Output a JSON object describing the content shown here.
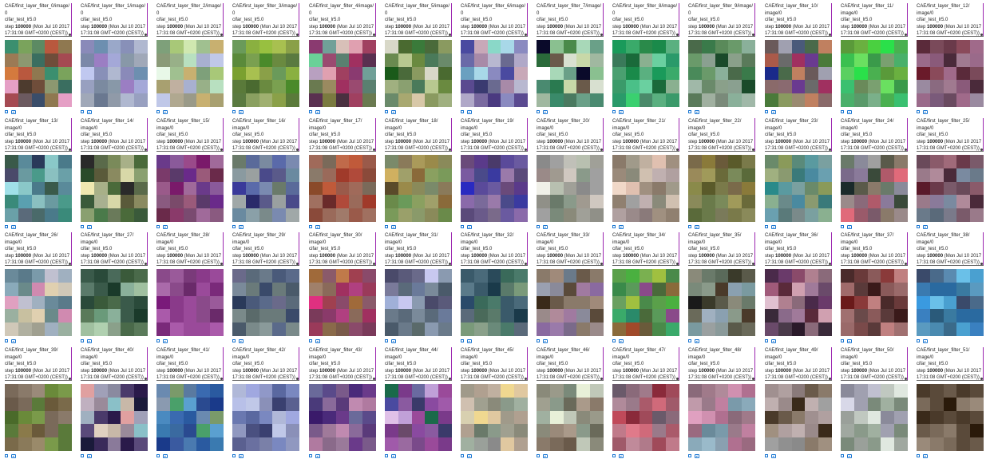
{
  "common": {
    "image_label": "image/0",
    "run": "cifar_test_lr5.0",
    "step_label": "step",
    "step_value": "100000",
    "date_line1": "(Mon Jul 10 2017",
    "date_line2": "17:31:08 GMT+0200 (CEST))"
  },
  "cards": [
    {
      "tag": "CAE/first_layer_filter_0/image/",
      "sub": "0"
    },
    {
      "tag": "CAE/first_layer_filter_1/image/",
      "sub": "0"
    },
    {
      "tag": "CAE/first_layer_filter_2/image/",
      "sub": "0"
    },
    {
      "tag": "CAE/first_layer_filter_3/image/",
      "sub": "0"
    },
    {
      "tag": "CAE/first_layer_filter_4/image/",
      "sub": "0"
    },
    {
      "tag": "CAE/first_layer_filter_5/image/",
      "sub": "0"
    },
    {
      "tag": "CAE/first_layer_filter_6/image/",
      "sub": "0"
    },
    {
      "tag": "CAE/first_layer_filter_7/image/",
      "sub": "0"
    },
    {
      "tag": "CAE/first_layer_filter_8/image/",
      "sub": "0"
    },
    {
      "tag": "CAE/first_layer_filter_9/image/",
      "sub": "0"
    },
    {
      "tag": "CAE/first_layer_filter_10/",
      "sub": "image/0"
    },
    {
      "tag": "CAE/first_layer_filter_11/",
      "sub": "image/0"
    },
    {
      "tag": "CAE/first_layer_filter_12/",
      "sub": "image/0"
    },
    {
      "tag": "CAE/first_layer_filter_13/",
      "sub": "image/0"
    },
    {
      "tag": "CAE/first_layer_filter_14/",
      "sub": "image/0"
    },
    {
      "tag": "CAE/first_layer_filter_15/",
      "sub": "image/0"
    },
    {
      "tag": "CAE/first_layer_filter_16/",
      "sub": "image/0"
    },
    {
      "tag": "CAE/first_layer_filter_17/",
      "sub": "image/0"
    },
    {
      "tag": "CAE/first_layer_filter_18/",
      "sub": "image/0"
    },
    {
      "tag": "CAE/first_layer_filter_19/",
      "sub": "image/0"
    },
    {
      "tag": "CAE/first_layer_filter_20/",
      "sub": "image/0"
    },
    {
      "tag": "CAE/first_layer_filter_21/",
      "sub": "image/0"
    },
    {
      "tag": "CAE/first_layer_filter_22/",
      "sub": "image/0"
    },
    {
      "tag": "CAE/first_layer_filter_23/",
      "sub": "image/0"
    },
    {
      "tag": "CAE/first_layer_filter_24/",
      "sub": "image/0"
    },
    {
      "tag": "CAE/first_layer_filter_25/",
      "sub": "image/0"
    },
    {
      "tag": "CAE/first_layer_filter_26/",
      "sub": "image/0"
    },
    {
      "tag": "CAE/first_layer_filter_27/",
      "sub": "image/0"
    },
    {
      "tag": "CAE/first_layer_filter_28/",
      "sub": "image/0"
    },
    {
      "tag": "CAE/first_layer_filter_29/",
      "sub": "image/0"
    },
    {
      "tag": "CAE/first_layer_filter_30/",
      "sub": "image/0"
    },
    {
      "tag": "CAE/first_layer_filter_31/",
      "sub": "image/0"
    },
    {
      "tag": "CAE/first_layer_filter_32/",
      "sub": "image/0"
    },
    {
      "tag": "CAE/first_layer_filter_33/",
      "sub": "image/0"
    },
    {
      "tag": "CAE/first_layer_filter_34/",
      "sub": "image/0"
    },
    {
      "tag": "CAE/first_layer_filter_35/",
      "sub": "image/0"
    },
    {
      "tag": "CAE/first_layer_filter_36/",
      "sub": "image/0"
    },
    {
      "tag": "CAE/first_layer_filter_37/",
      "sub": "image/0"
    },
    {
      "tag": "CAE/first_layer_filter_38/",
      "sub": "image/0"
    },
    {
      "tag": "CAE/first_layer_filter_39/",
      "sub": "image/0"
    },
    {
      "tag": "CAE/first_layer_filter_40/",
      "sub": "image/0"
    },
    {
      "tag": "CAE/first_layer_filter_41/",
      "sub": "image/0"
    },
    {
      "tag": "CAE/first_layer_filter_42/",
      "sub": "image/0"
    },
    {
      "tag": "CAE/first_layer_filter_43/",
      "sub": "image/0"
    },
    {
      "tag": "CAE/first_layer_filter_44/",
      "sub": "image/0"
    },
    {
      "tag": "CAE/first_layer_filter_45/",
      "sub": "image/0"
    },
    {
      "tag": "CAE/first_layer_filter_46/",
      "sub": "image/0"
    },
    {
      "tag": "CAE/first_layer_filter_47/",
      "sub": "image/0"
    },
    {
      "tag": "CAE/first_layer_filter_48/",
      "sub": "image/0"
    },
    {
      "tag": "CAE/first_layer_filter_49/",
      "sub": "image/0"
    },
    {
      "tag": "CAE/first_layer_filter_50/",
      "sub": "image/0"
    },
    {
      "tag": "CAE/first_layer_filter_51/",
      "sub": "image/0"
    }
  ],
  "palettes": [
    [
      "#3b8f6f",
      "#7aa35c",
      "#5c8a63",
      "#9b7a55",
      "#8c9870",
      "#3a6e60",
      "#d47a3e",
      "#b9583e",
      "#8f7850",
      "#e59fc5",
      "#4d3b2e",
      "#6f4d3a",
      "#a54a52",
      "#6c5a60",
      "#3a4d6a"
    ],
    [
      "#8a8ab9",
      "#6d8fb0",
      "#9aa8c9",
      "#7b88a8",
      "#9b7ec3",
      "#a4a8d8",
      "#c0c8f0",
      "#8890b8",
      "#b0b8d0",
      "#98a0c0",
      "#7b8aa0",
      "#8898a8",
      "#a0a8b8",
      "#6a7890",
      "#909aa8"
    ],
    [
      "#7ea07a",
      "#a8c878",
      "#d0e8b0",
      "#8a9a78",
      "#98b088",
      "#b8e0c0",
      "#e8f8e8",
      "#a0c090",
      "#c8b070",
      "#a8a070",
      "#c0b0a0",
      "#a8b0d0",
      "#c0c8e8",
      "#b0a890",
      "#9a9a88"
    ],
    [
      "#6a9a5a",
      "#8ab040",
      "#98c040",
      "#5a8a3a",
      "#7aa050",
      "#4a8a2a",
      "#7aa030",
      "#a8c050",
      "#8aa048",
      "#5a7a3a",
      "#4a6a30",
      "#6a8a40",
      "#5a7a40",
      "#8aa060",
      "#a0b070"
    ],
    [
      "#8a3a70",
      "#70a098",
      "#d8c0b8",
      "#6ad098",
      "#9a4a70",
      "#5a8070",
      "#b8a0c0",
      "#e0a0b0",
      "#a04060",
      "#6a7a50",
      "#9a8a60",
      "#a03060",
      "#5a3050",
      "#7a7a40",
      "#4a3040"
    ],
    [
      "#d8d8c8",
      "#4a6a30",
      "#3a7a3a",
      "#6a8a50",
      "#b8c890",
      "#6a8a40",
      "#1a5a1a",
      "#4a6a3a",
      "#8a9a60",
      "#a0b080",
      "#8aa070",
      "#4a7a5a",
      "#6a8a6a",
      "#a8a870",
      "#d8c8a8"
    ],
    [
      "#4a4aa0",
      "#c8a8b8",
      "#8ad8c8",
      "#6a6aa8",
      "#a88aa8",
      "#b8b8d0",
      "#6aa0c0",
      "#a8d8e8",
      "#8a8ac0",
      "#5a4a90",
      "#3a3a70",
      "#6a6a90",
      "#b0a8c8",
      "#7a6aa0",
      "#4a3a80"
    ],
    [
      "#0a0a2a",
      "#8ac090",
      "#4a8a4a",
      "#2a6a3a",
      "#6a5a4a",
      "#d8e0d0",
      "#ffffff",
      "#a8d8b8",
      "#6aa088",
      "#4a8a70",
      "#2a7a50",
      "#c8d8a8",
      "#a0b8a0",
      "#3a8a6a",
      "#4a7a60"
    ],
    [
      "#1a9a5a",
      "#3aaa6a",
      "#2a8a4a",
      "#3a7a5a",
      "#1a6a3a",
      "#8ab090",
      "#4aa070",
      "#1a8a4a",
      "#5ab080",
      "#3a9a6a",
      "#4ac088",
      "#6ad0a0",
      "#2a9a6a",
      "#3ad070",
      "#4a8a6a"
    ],
    [
      "#4a6a4a",
      "#3a7a4a",
      "#5a8a5a",
      "#6a9a6a",
      "#8aa090",
      "#1a4a2a",
      "#4a8a5a",
      "#6a9a6a",
      "#8ab09a",
      "#a0b8a8",
      "#6a8a6a",
      "#8aa08a",
      "#5a7a5a",
      "#a0b0a0",
      "#7a8a7a"
    ],
    [
      "#6a5a5a",
      "#a0a0b0",
      "#4a5a7a",
      "#aa5a4a",
      "#6a6a6a",
      "#a03060",
      "#1a2a8a",
      "#4a6a4a",
      "#c08060",
      "#8a6a6a",
      "#8a6a70",
      "#6a3a90",
      "#4a7a3a",
      "#8a9a60",
      "#9a8a70"
    ],
    [
      "#5a9a3a",
      "#6ab040",
      "#4ad040",
      "#3ac050",
      "#6ae060",
      "#3a9a4a",
      "#5ad060",
      "#2ae04a",
      "#4ab050",
      "#3ac070",
      "#6a8a5a",
      "#7aa070",
      "#4ab06a",
      "#5a9a6a",
      "#7ab08a"
    ],
    [
      "#5a2a3a",
      "#7a4a5a",
      "#6a3a4a",
      "#9a6a8a",
      "#8a5a7a",
      "#4a2a3a",
      "#6a1a2a",
      "#8a4a5a",
      "#a06a8a",
      "#9a8aa0",
      "#8a6a80",
      "#a07a90",
      "#9a6a8a",
      "#7a5a7a",
      "#6a4a60"
    ],
    [
      "#3a5a4a",
      "#5a8a9a",
      "#2a3a5a",
      "#4a4a6a",
      "#6a9aa0",
      "#4a9a8a",
      "#a0e0e8",
      "#8ac8c8",
      "#4a7a8a",
      "#3a8a7a",
      "#5aa0b0",
      "#8ac0c0",
      "#6aa0a8",
      "#5a6a7a",
      "#4a6a6a"
    ],
    [
      "#2a2a2a",
      "#5a6a4a",
      "#7a8a5a",
      "#2a4a2a",
      "#5a5a3a",
      "#8a8a60",
      "#f0e8b0",
      "#a8b088",
      "#4a6a3a",
      "#3a5a3a",
      "#a8b090",
      "#d8d8a8",
      "#8aa070",
      "#4a7a4a",
      "#6a7a5a"
    ],
    [
      "#6a3a8a",
      "#8a5a9a",
      "#9a4a8a",
      "#7a3a6a",
      "#5a3a6a",
      "#6a2a8a",
      "#9a5a8a",
      "#7a1a6a",
      "#a06a9a",
      "#8a5a80",
      "#7a4a6a",
      "#9a5a7a",
      "#6a2a4a",
      "#8a3a6a",
      "#7a4a70"
    ],
    [
      "#6a7a6a",
      "#5a6a9a",
      "#7a8aa0",
      "#8a9aa0",
      "#9aa0a0",
      "#4a4a8a",
      "#3a3a9a",
      "#5a6aaa",
      "#7a8ab0",
      "#a0a8a8",
      "#2a2a6a",
      "#5a5a8a",
      "#6a8aa0",
      "#8aa0a8",
      "#7a8a8a"
    ],
    [
      "#a06a5a",
      "#7a6a5a",
      "#c06a4a",
      "#8a7a6a",
      "#9a6a5a",
      "#a03a2a",
      "#8a4a2a",
      "#c05a3a",
      "#9a5a4a",
      "#a07060",
      "#6a2a2a",
      "#b04a3a",
      "#8a4a3a",
      "#9a6a5a",
      "#a07a6a"
    ],
    [
      "#7a8a6a",
      "#8a7a5a",
      "#aa9a5a",
      "#d0b060",
      "#a0a06a",
      "#8a6a3a",
      "#5a4a2a",
      "#9a8a4a",
      "#8a8a5a",
      "#6a8a4a",
      "#6a9a5a",
      "#8aa060",
      "#7a9a5a",
      "#9aa06a",
      "#8a9a6a"
    ],
    [
      "#6a4a7a",
      "#5a3a8a",
      "#4a3a6a",
      "#7a5aa0",
      "#4a4a8a",
      "#3a3aa0",
      "#2a2ac0",
      "#5a4a9a",
      "#6a5aa0",
      "#8a6aaa",
      "#7a6a9a",
      "#9a7aaa",
      "#5a4a7a",
      "#6a5a8a",
      "#7a6a8a"
    ],
    [
      "#8a8a8a",
      "#a0a0a0",
      "#c0c0b8",
      "#9a8a88",
      "#a09a90",
      "#d0c8c0",
      "#f0f0e8",
      "#b8c0b0",
      "#a0a098",
      "#909088",
      "#6a7a6a",
      "#8a9a8a",
      "#a0a0a0",
      "#7a8a7a",
      "#8a8a7a"
    ],
    [
      "#8a7a6a",
      "#a09a8a",
      "#c0b0a0",
      "#9a8a7a",
      "#8a8a7a",
      "#d0c0b0",
      "#f0d8c8",
      "#e0c0b0",
      "#a09080",
      "#908070",
      "#a0a0a0",
      "#c0b0b0",
      "#b0a0a0",
      "#9a8a8a",
      "#8a7a7a"
    ],
    [
      "#7a6a4a",
      "#8a7a3a",
      "#6a5a3a",
      "#9a8a5a",
      "#a09a5a",
      "#6a6a3a",
      "#8a8a4a",
      "#5a5a2a",
      "#7a7a4a",
      "#8a8a5a",
      "#6a7a4a",
      "#7a8a5a",
      "#5a6a3a",
      "#6a7a4a",
      "#7a7a5a"
    ],
    [
      "#6a8a6a",
      "#8a9a5a",
      "#5a8a7a",
      "#a0b080",
      "#8a9a70",
      "#3a7a7a",
      "#2a8a8a",
      "#5a9aa0",
      "#7aa0a0",
      "#8ab090",
      "#6a8a8a",
      "#4a8aa0",
      "#6aa0b0",
      "#5a7a7a",
      "#7a8a8a"
    ],
    [
      "#6a7a6a",
      "#8a8a9a",
      "#a0a0a0",
      "#7a6a8a",
      "#8a7a9a",
      "#3a4a3a",
      "#1a2a2a",
      "#5a5a4a",
      "#8a7a6a",
      "#9a8a8a",
      "#8a6a7a",
      "#b05a6a",
      "#e06a7a",
      "#9a5a6a",
      "#7a5a6a"
    ],
    [
      "#6a4a5a",
      "#8a5a6a",
      "#a06a7a",
      "#9a7a8a",
      "#b08a9a",
      "#4a2a3a",
      "#5a1a2a",
      "#6a3a4a",
      "#7a5a6a",
      "#9a7a8a",
      "#8a7a9a",
      "#7a8aa0",
      "#6a7a8a",
      "#5a6a7a",
      "#7a7a8a"
    ],
    [
      "#6a8a9a",
      "#5a7a8a",
      "#7a9aaa",
      "#8aaaba",
      "#6a8a8a",
      "#d08ab0",
      "#e0a0c0",
      "#c0c0d0",
      "#a0b0c0",
      "#9ab0a0",
      "#c8c0a0",
      "#e0d0b0",
      "#d0c8b8",
      "#b0b0a0",
      "#a0a090"
    ],
    [
      "#3a5a4a",
      "#2a4a3a",
      "#4a6a5a",
      "#5a7a6a",
      "#3a5a4a",
      "#1a3a2a",
      "#2a4a3a",
      "#3a5a3a",
      "#4a6a4a",
      "#5a7a5a",
      "#6a9a7a",
      "#8ab09a",
      "#a0c0a0",
      "#b0d0b0",
      "#8aa08a"
    ],
    [
      "#8a4a8a",
      "#9a5a9a",
      "#7a3a7a",
      "#aa6aaa",
      "#8a4a8a",
      "#6a2a6a",
      "#7a1a7a",
      "#8a3a8a",
      "#9a4a9a",
      "#aa5aaa",
      "#8a3a8a",
      "#9a4a9a",
      "#7a2a7a",
      "#aa5aaa",
      "#9a4a9a"
    ],
    [
      "#6a6a8a",
      "#5a6a7a",
      "#6a7a8a",
      "#7a8a9a",
      "#6a7a7a",
      "#3a4a6a",
      "#2a3a5a",
      "#4a5a7a",
      "#5a6a8a",
      "#7a8a8a",
      "#5a6a6a",
      "#6a7a7a",
      "#4a5a6a",
      "#7a8a8a",
      "#8a9a9a"
    ],
    [
      "#a06a3a",
      "#8a5a6a",
      "#c07a4a",
      "#a0806a",
      "#8a6a5a",
      "#a03060",
      "#e03080",
      "#a04050",
      "#8a4a6a",
      "#7a3a5a",
      "#8a3a6a",
      "#b04080",
      "#9a3a5a",
      "#8a6a4a",
      "#7a5a4a"
    ],
    [
      "#4a4a6a",
      "#5a5a7a",
      "#6a6a8a",
      "#7a7a9a",
      "#5a6a7a",
      "#6a7a9a",
      "#a0b0d8",
      "#c8c8f0",
      "#8a9ab0",
      "#6a7a8a",
      "#5a6a7a",
      "#7a8a9a",
      "#4a5a6a",
      "#6a7a8a",
      "#5a6a6a"
    ],
    [
      "#3a5a6a",
      "#4a6a7a",
      "#2a4a5a",
      "#5a7a8a",
      "#3a5a6a",
      "#1a3a4a",
      "#2a4a6a",
      "#3a6a5a",
      "#4a7a6a",
      "#5a6a7a",
      "#4a6a5a",
      "#5a7a6a",
      "#7a9a7a",
      "#8aa08a",
      "#6a8a7a"
    ],
    [
      "#8a7a6a",
      "#a08a7a",
      "#6a7a8a",
      "#9aa0b0",
      "#8a8a9a",
      "#5a4a3a",
      "#3a2a1a",
      "#6a5a4a",
      "#8a7a6a",
      "#9a8a8a",
      "#b08a9a",
      "#a07aa0",
      "#8a6aa0",
      "#9a7aaa",
      "#7a6a8a"
    ],
    [
      "#5aa04a",
      "#4ab040",
      "#7ab050",
      "#3a8a4a",
      "#5a9a5a",
      "#8a4a8a",
      "#6aa060",
      "#a0c040",
      "#4a8a4a",
      "#3aaa6a",
      "#2a8a6a",
      "#4a6a3a",
      "#8a6a3a",
      "#a04a2a",
      "#6a5a3a"
    ],
    [
      "#8a8a7a",
      "#6a7a6a",
      "#5a6a5a",
      "#7a8a7a",
      "#8a9a8a",
      "#4a3a2a",
      "#1a1a1a",
      "#3a3a2a",
      "#5a5a4a",
      "#6a6a5a",
      "#a0b0c0",
      "#8aa0b0",
      "#7a9aa0",
      "#9aa0a0",
      "#8a9a9a"
    ],
    [
      "#4a2a4a",
      "#6a3a6a",
      "#8a4a6a",
      "#a05a7a",
      "#5a2a3a",
      "#d0a0b0",
      "#e0c0d0",
      "#b08090",
      "#8a6a7a",
      "#3a2a3a",
      "#8a6a8a",
      "#a07a9a",
      "#6a4a6a",
      "#4a3a4a",
      "#2a1a2a"
    ],
    [
      "#4a2a2a",
      "#6a3a3a",
      "#8a5a5a",
      "#a06a6a",
      "#5a3a3a",
      "#3a1a1a",
      "#6a1a1a",
      "#8a3a3a",
      "#c08080",
      "#a07070",
      "#6a4a4a",
      "#8a5a5a",
      "#9a6a6a",
      "#7a4a4a",
      "#5a3a3a"
    ],
    [
      "#3a4a6a",
      "#4a6a8a",
      "#5a8ab0",
      "#3a7ab0",
      "#2a6aa0",
      "#2a6aa0",
      "#3a9ae0",
      "#6ac0e8",
      "#4aa0d0",
      "#3a80c0",
      "#2a5a7a",
      "#3a7aa0",
      "#5a9ac0",
      "#4a8ab0",
      "#3a6a8a"
    ],
    [
      "#7a6a5a",
      "#8a7a6a",
      "#9a8a7a",
      "#6a5a4a",
      "#7a6a5a",
      "#5a7a3a",
      "#4a6a2a",
      "#6a8a3a",
      "#7a9a4a",
      "#5a7a3a",
      "#8a7a4a",
      "#6a5a3a",
      "#7a6a4a",
      "#8a7a5a",
      "#9a8a6a"
    ],
    [
      "#e0a0a0",
      "#a0a0b8",
      "#8a8aa0",
      "#c0b0c0",
      "#9a8a9a",
      "#8ac0c8",
      "#a0b0c0",
      "#4a3a6a",
      "#2a1a4a",
      "#5a4a7a",
      "#e0d0c0",
      "#c8b8a8",
      "#1a1a3a",
      "#3a2a5a",
      "#8a7a9a"
    ],
    [
      "#6a8ab0",
      "#7a9a6a",
      "#5a7aa0",
      "#8a9ab0",
      "#4aa06a",
      "#5aa0d0",
      "#4a8ac0",
      "#3a6ab0",
      "#2a5aa0",
      "#3a7ab0",
      "#3a6aa0",
      "#2a4a90",
      "#1a3a8a",
      "#3a5aa0",
      "#4a7ab0"
    ],
    [
      "#b0b8d8",
      "#a0a8e0",
      "#9098c8",
      "#b8c0e8",
      "#c0c8e8",
      "#8a90b8",
      "#6a78b0",
      "#5a68a0",
      "#7a88c0",
      "#9098c0",
      "#4a5080",
      "#3a4070",
      "#5a6090",
      "#6a70a0",
      "#7a80a8"
    ],
    [
      "#6a6a9a",
      "#5a4a8a",
      "#7a5a8a",
      "#4a3a7a",
      "#8a6a9a",
      "#5a3a7a",
      "#3a1a6a",
      "#4a2a7a",
      "#6a3a8a",
      "#7a5a8a",
      "#a07a9a",
      "#c08ab0",
      "#b07aa0",
      "#8a6a8a",
      "#9a7a9a"
    ],
    [
      "#1a6a4a",
      "#7a3a8a",
      "#6a6aa0",
      "#4a4aa0",
      "#8a5aa0",
      "#3a3a6a",
      "#e0c0e8",
      "#c0a0d8",
      "#9a4a9a",
      "#7a3a8a",
      "#6a4a6a",
      "#8a4aa0",
      "#a05aaa",
      "#9a6aa0",
      "#7a4a8a"
    ],
    [
      "#a09a8a",
      "#b0a090",
      "#c0b0a0",
      "#d0c0b0",
      "#a0a090",
      "#8a8a7a",
      "#d8d0b0",
      "#f0d890",
      "#e0c8a0",
      "#b0a090",
      "#6a7a6a",
      "#8a9a8a",
      "#a0b0a0",
      "#9aa09a",
      "#8a8a8a"
    ],
    [
      "#8a8a7a",
      "#9a9a8a",
      "#7a8a7a",
      "#a0a090",
      "#8a9a8a",
      "#6a6a5a",
      "#a0b0a0",
      "#e8f0d8",
      "#c0c8b8",
      "#8a8a7a",
      "#9a8a7a",
      "#aa9a8a",
      "#8a7a6a",
      "#7a6a5a",
      "#6a5a4a"
    ],
    [
      "#6a5a6a",
      "#8a6a7a",
      "#a07a8a",
      "#b08a9a",
      "#9a7a8a",
      "#aa5a6a",
      "#c04a5a",
      "#8a2a3a",
      "#a04a5a",
      "#c07a8a",
      "#e07a8a",
      "#d06a7a",
      "#a05a6a",
      "#c08a9a",
      "#b07a8a"
    ],
    [
      "#8a6a7a",
      "#a07a8a",
      "#b08a9a",
      "#c09aaa",
      "#9a7a8a",
      "#c080a0",
      "#e0a0c0",
      "#d090b0",
      "#b07090",
      "#9a6a80",
      "#6a8a9a",
      "#7a9aaa",
      "#8aaaba",
      "#9abaca",
      "#8aa0b0"
    ],
    [
      "#a09090",
      "#b0a0a0",
      "#8a7a7a",
      "#c0b0b0",
      "#9a8a8a",
      "#3a2a1a",
      "#4a3a2a",
      "#6a5a4a",
      "#8a7a6a",
      "#a09080",
      "#b0a0a0",
      "#c0b0b0",
      "#a0a0a0",
      "#909090",
      "#8a8a8a"
    ],
    [
      "#8a8a9a",
      "#a0a0b0",
      "#c0c0d0",
      "#d8d8e8",
      "#a0a0b0",
      "#7a8a7a",
      "#9aa09a",
      "#c0c8c0",
      "#e0e8e0",
      "#a0a8a0",
      "#8a9a8a",
      "#a0b0a0",
      "#7a8a7a",
      "#9aa09a",
      "#8a9a8a"
    ],
    [
      "#4a3a2a",
      "#5a4a3a",
      "#6a5a4a",
      "#7a6a5a",
      "#5a4a3a",
      "#2a1a0a",
      "#3a2a1a",
      "#4a3a2a",
      "#5a4a3a",
      "#6a5a4a",
      "#7a6a5a",
      "#8a7a6a",
      "#9a8a7a",
      "#8a7a6a",
      "#7a6a5a"
    ]
  ]
}
